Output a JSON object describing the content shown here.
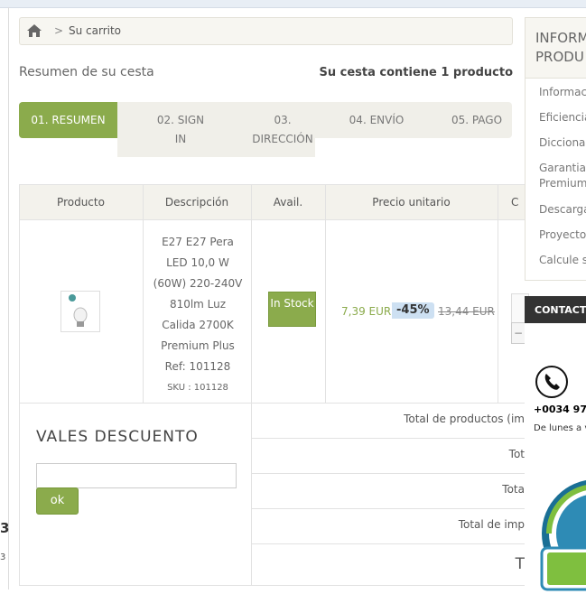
{
  "breadcrumb": {
    "current": "Su carrito",
    "separator": ">"
  },
  "summary": {
    "title": "Resumen de su cesta",
    "count_text": "Su cesta contiene 1 producto"
  },
  "steps": [
    {
      "label": "01. RESUMEN",
      "active": true
    },
    {
      "label": "02. SIGN IN",
      "line1": "02. SIGN",
      "line2": "IN"
    },
    {
      "label": "03. DIRECCIÓN",
      "line1": "03.",
      "line2": "DIRECCIÓN"
    },
    {
      "label": "04. ENVÍO"
    },
    {
      "label": "05. PAGO"
    }
  ],
  "table": {
    "headers": [
      "Producto",
      "Descripción",
      "Avail.",
      "Precio unitario",
      "C"
    ],
    "product": {
      "description_lines": [
        "E27 E27 Pera",
        "LED 10,0 W",
        "(60W) 220-240V",
        "810lm Luz",
        "Calida 2700K",
        "Premium Plus",
        "Ref: 101128"
      ],
      "sku": "SKU : 101128",
      "availability": "In Stock",
      "price": "7,39 EUR",
      "discount": "-45%",
      "old_price": "13,44 EUR"
    },
    "totals": [
      "Total de productos (im",
      "Tot",
      "Tota",
      "Total de imp",
      "T"
    ]
  },
  "vouchers": {
    "title": "VALES DESCUENTO",
    "input_value": "",
    "button_label": "ok"
  },
  "sidebar": {
    "title_line1": "INFORM",
    "title_line2": "PRODU",
    "items": [
      "Informac",
      "Eficiencia",
      "Diccionar",
      "Garantia",
      "Premium",
      "Descarga",
      "Proyecto",
      "Calcule s"
    ]
  },
  "contact": {
    "title": "CONTACT",
    "phone": "+0034 977",
    "hours": "De lunes a v"
  },
  "left_partial": {
    "num1": "3",
    "num2": "3"
  },
  "colors": {
    "accent_green": "#8bab4c",
    "discount_blue": "#cde0f2",
    "panel_beige": "#f0efe9"
  }
}
